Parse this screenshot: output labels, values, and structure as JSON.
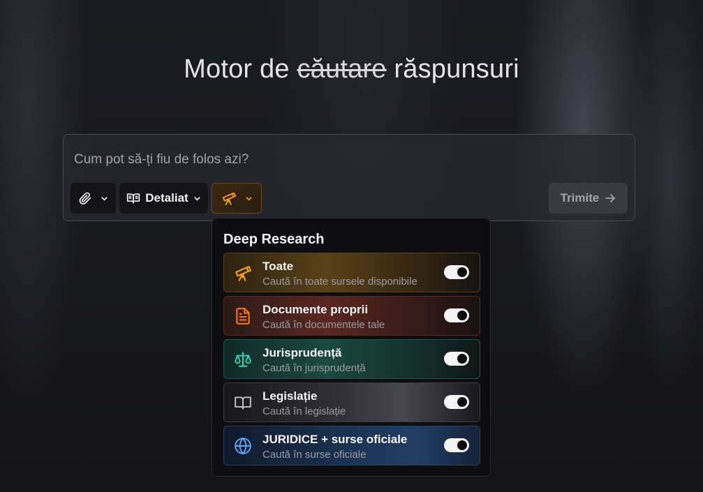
{
  "headline": {
    "prefix": "Motor de",
    "struck": "căutare",
    "suffix": "răspunsuri"
  },
  "composer": {
    "placeholder": "Cum pot să-ți fiu de folos azi?",
    "attach_icon": "paperclip-icon",
    "mode_label": "Detaliat",
    "mode_icon": "open-book-icon",
    "research_icon": "telescope-icon",
    "send_label": "Trimite",
    "send_icon": "arrow-right-icon"
  },
  "dropdown": {
    "title": "Deep Research",
    "options": [
      {
        "title": "Toate",
        "subtitle": "Caută în toate sursele disponibile",
        "icon": "telescope-icon",
        "enabled": true,
        "color": "#f59e0b"
      },
      {
        "title": "Documente proprii",
        "subtitle": "Caută în documentele tale",
        "icon": "document-icon",
        "enabled": true,
        "color": "#f97316"
      },
      {
        "title": "Jurisprudență",
        "subtitle": "Caută în jurisprudență",
        "icon": "scales-icon",
        "enabled": true,
        "color": "#2dd4bf"
      },
      {
        "title": "Legislație",
        "subtitle": "Caută în legislație",
        "icon": "book-icon",
        "enabled": true,
        "color": "#c4c4c8"
      },
      {
        "title": "JURIDICE + surse oficiale",
        "subtitle": "Caută în surse oficiale",
        "icon": "globe-icon",
        "enabled": true,
        "color": "#60a5fa"
      }
    ]
  }
}
